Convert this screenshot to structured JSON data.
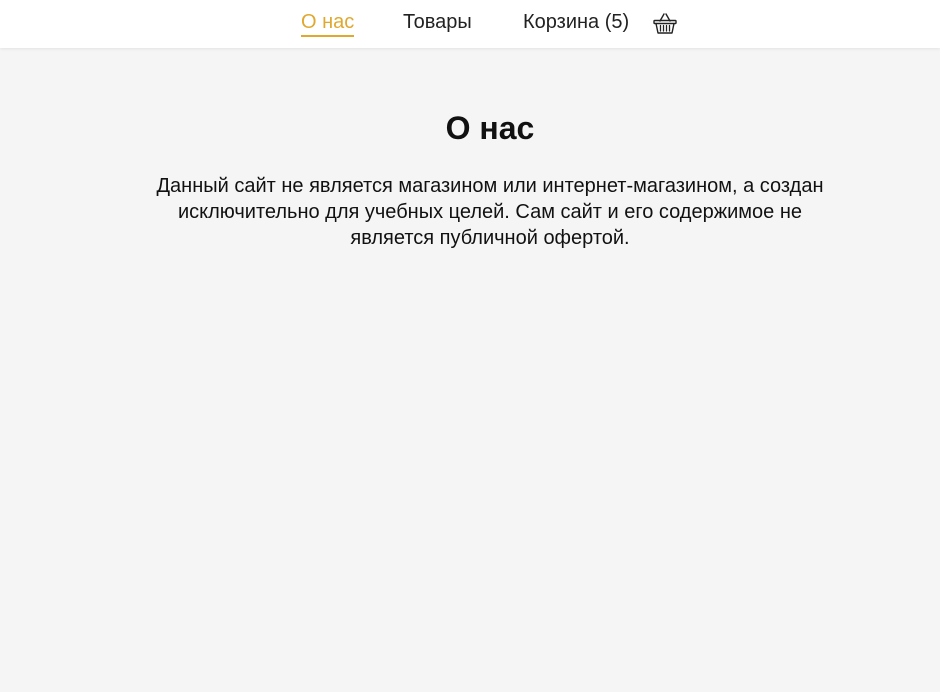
{
  "nav": {
    "about_label": "О нас",
    "products_label": "Товары",
    "cart_label": "Корзина (5)",
    "active_color": "#e0a82e",
    "cart_icon": "basket-icon"
  },
  "main": {
    "title": "О нас",
    "text": "Данный сайт не является магазином или интернет-магазином, а создан исключительно для учебных целей. Сам сайт и его содержимое не является публичной офертой."
  }
}
